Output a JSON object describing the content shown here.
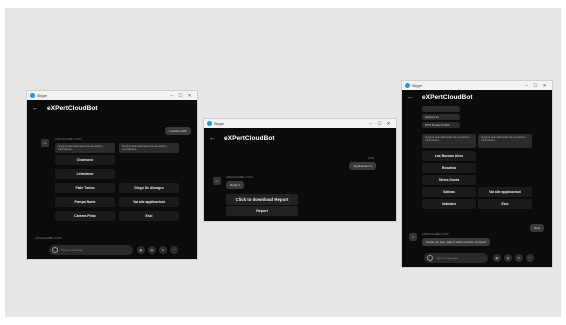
{
  "window_title": "Skype",
  "bot_name": "eXPertCloudBot",
  "controls": {
    "minimize": "–",
    "maximize": "☐",
    "close": "✕"
  },
  "composer_placeholder": "Type a message",
  "win1": {
    "user_msg": "Impianti GDF",
    "bot_meta": "eXPertCloudBot, 16:00",
    "card_left": "Scegli la sede della quale hai necessità di informazione...",
    "card_right": "Scegli la sede della quale hai necessità di consultazione",
    "buttons": [
      "Chamonix",
      "",
      "Lebedeme",
      "",
      "Fiale Torino",
      "Diego De Almagro",
      "Pampa Norte",
      "Vai alle applicazioni",
      "Carrera Pinto",
      "Esci"
    ],
    "bottom_meta": "eXPertCloudBot, 16:00"
  },
  "win2": {
    "time": "15:00",
    "user_msg": "Applicazioni 1",
    "bot_meta": "eXPertCloudBot, 15:00",
    "bot_msg": "Nodo 3",
    "download_label": "Click to download Report",
    "report_label": "Report"
  },
  "win3": {
    "top_lines": [
      "...",
      "Ambiente 34",
      "RTTX Provider SYSNS"
    ],
    "card_left": "Scegli la sede della quale hai necessità di informazione...",
    "card_right": "Scegli la sede della quale hai necessità di informazione...",
    "buttons": [
      "Las Buenas Aires",
      "",
      "Rosalina",
      "",
      "Sierra Gorda",
      "",
      "Salinas",
      "Vai alle applicazioni",
      "Imbiotes",
      "Esci"
    ],
    "user_msg": "Esci",
    "bot_meta": "eXPertCloudBot, 16:00",
    "bot_msg": "Grazie per aver usato il nostro servizio. A presto!"
  }
}
